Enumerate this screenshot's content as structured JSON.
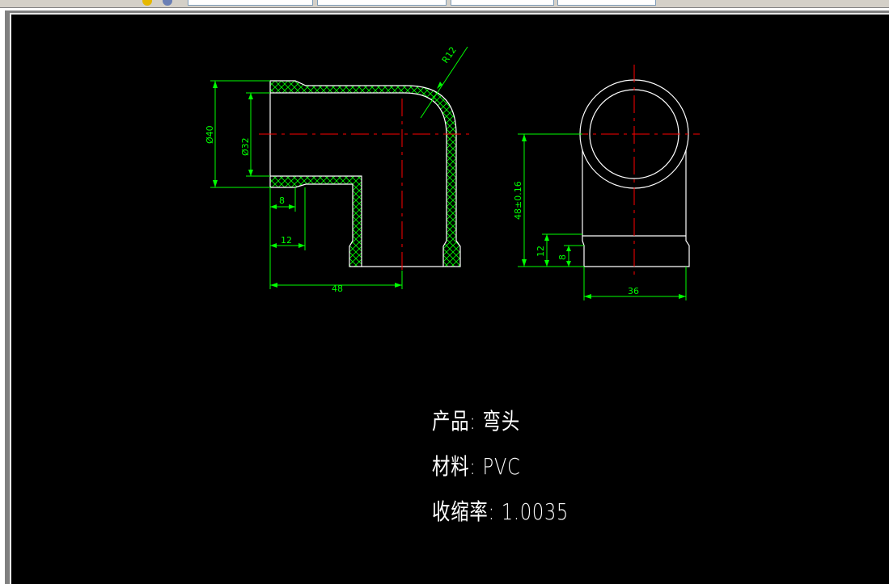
{
  "app": {
    "canvas_background": "#000000",
    "chrome_color": "#d4d0c8"
  },
  "colors": {
    "outline": "#ffffff",
    "dimension": "#00ff00",
    "centerline": "#ff0000",
    "hatch": "#00ff00"
  },
  "drawing": {
    "dimensions": {
      "outer_dia": "Ø40",
      "inner_dia": "Ø32",
      "radius": "R12",
      "socket_depth_8": "8",
      "socket_depth_12": "12",
      "length_48": "48",
      "height_48": "48±0.16",
      "side_12": "12",
      "side_8": "8",
      "width_36": "36"
    }
  },
  "notes": {
    "product": "产品: 弯头",
    "material": "材料: PVC",
    "shrinkage": "收缩率: 1.0035"
  }
}
